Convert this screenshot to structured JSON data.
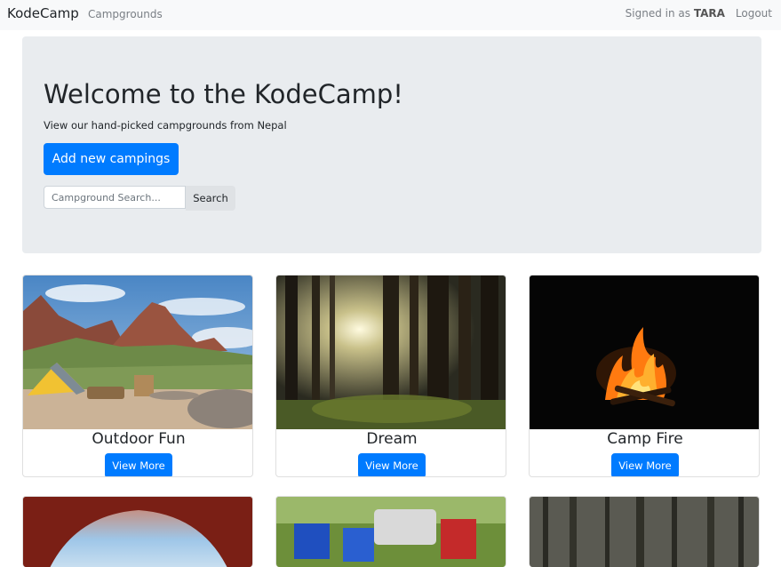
{
  "navbar": {
    "brand": "KodeCamp",
    "links": [
      "Campgrounds"
    ],
    "signed_in_prefix": "Signed in as",
    "username": "TARA",
    "logout": "Logout"
  },
  "hero": {
    "title": "Welcome to the KodeCamp!",
    "subtitle": "View our hand-picked campgrounds from Nepal",
    "add_button": "Add new campings",
    "search_placeholder": "Campground Search...",
    "search_button": "Search"
  },
  "campgrounds": [
    {
      "name": "Outdoor Fun",
      "button": "View More"
    },
    {
      "name": "Dream",
      "button": "View More"
    },
    {
      "name": "Camp Fire",
      "button": "View More"
    }
  ],
  "colors": {
    "primary": "#007bff",
    "jumbotron": "#e9ecef",
    "navbar": "#f8f9fa"
  }
}
